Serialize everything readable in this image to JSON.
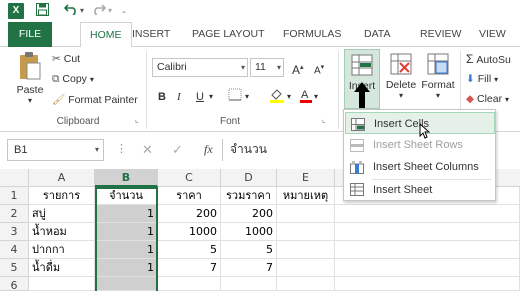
{
  "qat": {
    "logo": "X"
  },
  "tabs": [
    "FILE",
    "HOME",
    "INSERT",
    "PAGE LAYOUT",
    "FORMULAS",
    "DATA",
    "REVIEW",
    "VIEW"
  ],
  "clipboard": {
    "paste": "Paste",
    "cut": "Cut",
    "copy": "Copy",
    "format_painter": "Format Painter",
    "label": "Clipboard"
  },
  "font": {
    "name": "Calibri",
    "size": "11",
    "label": "Font",
    "bold": "B",
    "italic": "I",
    "underline": "U"
  },
  "cells_group": {
    "insert": "Insert",
    "delete": "Delete",
    "format": "Format"
  },
  "editing": {
    "autosum": "AutoSu",
    "fill": "Fill",
    "clear": "Clear"
  },
  "formula_bar": {
    "name_box": "B1",
    "fx": "fx",
    "content": "จำนวน"
  },
  "columns": [
    "A",
    "B",
    "C",
    "D",
    "E"
  ],
  "rows": [
    "1",
    "2",
    "3",
    "4",
    "5",
    "6"
  ],
  "cells": {
    "r1": [
      "รายการ",
      "จำนวน",
      "ราคา",
      "รวมราคา",
      "หมายเหตุ"
    ],
    "r2": [
      "สบู่",
      "1",
      "200",
      "200",
      ""
    ],
    "r3": [
      "น้ำหอม",
      "1",
      "1000",
      "1000",
      ""
    ],
    "r4": [
      "ปากกา",
      "1",
      "5",
      "5",
      ""
    ],
    "r5": [
      "น้ำดื่ม",
      "1",
      "7",
      "7",
      ""
    ],
    "r6": [
      "",
      "",
      "",
      "",
      ""
    ]
  },
  "menu": {
    "items": [
      "Insert Cells",
      "Insert Sheet Rows",
      "Insert Sheet Columns",
      "Insert Sheet"
    ]
  },
  "colors": {
    "accent": "#217346",
    "selection": "#cfcfcf"
  }
}
